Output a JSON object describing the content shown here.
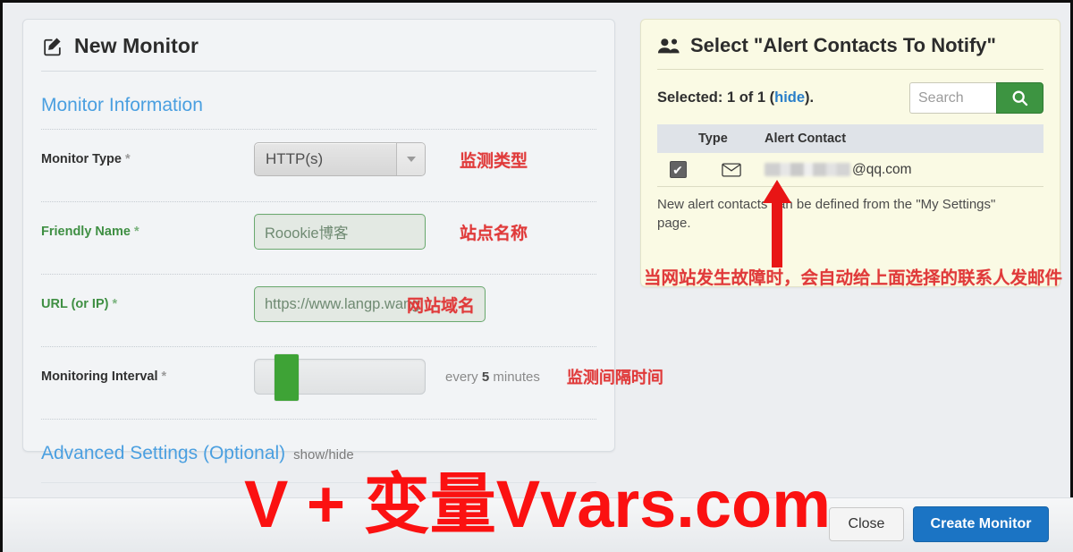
{
  "left_panel": {
    "title": "New Monitor",
    "title_icon": "edit-square-icon",
    "section_heading": "Monitor Information",
    "fields": {
      "monitor_type": {
        "label": "Monitor Type",
        "required_mark": "*",
        "value": "HTTP(s)",
        "annotation": "监测类型"
      },
      "friendly_name": {
        "label": "Friendly Name",
        "required_mark": "*",
        "value": "Roookie博客",
        "annotation": "站点名称"
      },
      "url": {
        "label": "URL (or IP)",
        "required_mark": "*",
        "value": "https://www.langp.wang",
        "annotation": "网站域名"
      },
      "interval": {
        "label": "Monitoring Interval",
        "required_mark": "*",
        "text_prefix": "every",
        "value": "5",
        "text_suffix": "minutes",
        "annotation": "监测间隔时间"
      }
    },
    "advanced": {
      "label": "Advanced Settings (Optional)",
      "toggle": "show/hide"
    }
  },
  "right_panel": {
    "title": "Select \"Alert Contacts To Notify\"",
    "title_icon": "users-icon",
    "selected_text_prefix": "Selected: 1 of 1 (",
    "selected_link": "hide",
    "selected_text_suffix": ").",
    "search": {
      "placeholder": "Search",
      "button_icon": "search-icon"
    },
    "table": {
      "columns": [
        "Type",
        "Alert Contact"
      ],
      "rows": [
        {
          "checked": true,
          "type_icon": "envelope-icon",
          "contact_redacted": true,
          "contact_suffix": "@qq.com"
        }
      ]
    },
    "help_text": "New alert contacts can be defined from the \"My Settings\" page.",
    "annotation": "当网站发生故障时，会自动给上面选择的联系人发邮件",
    "arrow_icon": "red-up-arrow-icon"
  },
  "footer": {
    "close_label": "Close",
    "create_label": "Create Monitor"
  },
  "watermark": {
    "text": "V + 变量Vvars.com"
  },
  "colors": {
    "accent_blue": "#4a9fe0",
    "valid_green": "#3f8f43",
    "annotation_red": "#e03a3a",
    "watermark_red": "#fb1111",
    "search_green": "#3d9441",
    "create_blue": "#1b74c4",
    "right_panel_bg": "#fafae4"
  }
}
